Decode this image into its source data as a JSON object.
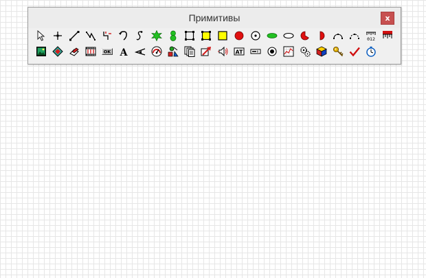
{
  "window": {
    "title": "Примитивы",
    "close_label": "x"
  },
  "toolbar": {
    "row1": [
      {
        "name": "pointer-icon"
      },
      {
        "name": "crosshair-icon"
      },
      {
        "name": "line-icon"
      },
      {
        "name": "polyline-icon"
      },
      {
        "name": "connector-icon"
      },
      {
        "name": "arc-arrow-icon"
      },
      {
        "name": "curve-icon"
      },
      {
        "name": "green-star-icon"
      },
      {
        "name": "green-figure-icon"
      },
      {
        "name": "rectangle-icon"
      },
      {
        "name": "filled-rectangle-icon"
      },
      {
        "name": "yellow-square-icon"
      },
      {
        "name": "red-circle-icon"
      },
      {
        "name": "circle-dot-icon"
      },
      {
        "name": "green-ellipse-icon"
      },
      {
        "name": "ellipse-icon"
      },
      {
        "name": "pie-icon"
      },
      {
        "name": "half-circle-icon"
      },
      {
        "name": "arc-icon"
      },
      {
        "name": "arc-dashed-icon"
      },
      {
        "name": "scale-icon",
        "text": "012"
      },
      {
        "name": "bar-indicator-icon"
      }
    ],
    "row2": [
      {
        "name": "image-icon"
      },
      {
        "name": "diamond-icon"
      },
      {
        "name": "eraser-icon"
      },
      {
        "name": "film-icon"
      },
      {
        "name": "ok-button-icon",
        "text": "OK"
      },
      {
        "name": "text-icon",
        "text": "A"
      },
      {
        "name": "arrow-angle-icon"
      },
      {
        "name": "gauge-icon"
      },
      {
        "name": "objects-icon"
      },
      {
        "name": "pages-icon"
      },
      {
        "name": "red-arrow-icon"
      },
      {
        "name": "speaker-icon"
      },
      {
        "name": "textbox-icon",
        "text": "AT"
      },
      {
        "name": "edit-field-icon"
      },
      {
        "name": "radio-button-icon"
      },
      {
        "name": "graph-icon"
      },
      {
        "name": "gears-icon"
      },
      {
        "name": "color-cube-icon"
      },
      {
        "name": "key-icon"
      },
      {
        "name": "checkmark-icon"
      },
      {
        "name": "stopwatch-icon"
      }
    ]
  }
}
